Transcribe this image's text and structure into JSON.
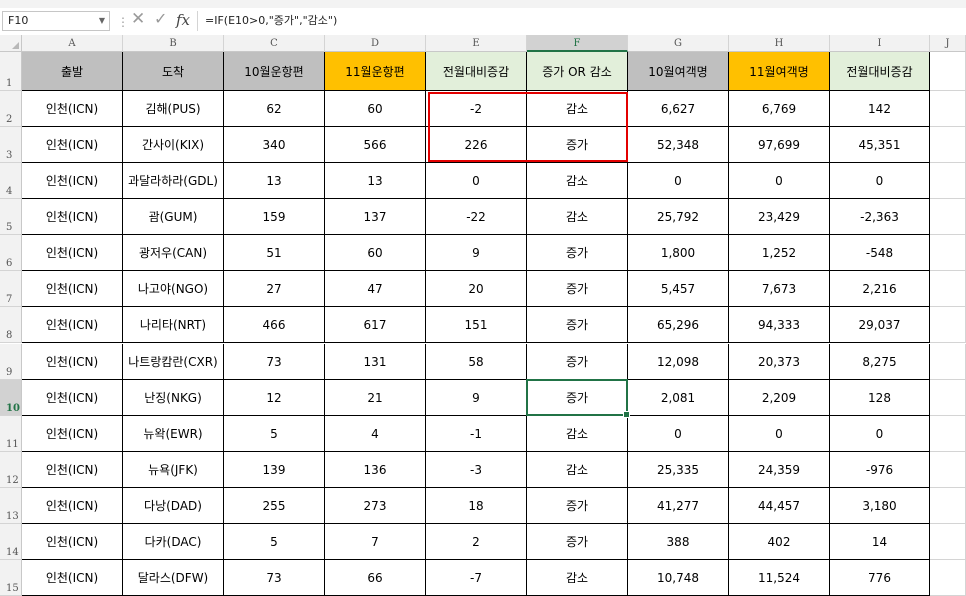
{
  "formula_bar": {
    "name_box": "F10",
    "formula": "=IF(E10>0,\"증가\",\"감소\")",
    "cancel_icon": "close-icon",
    "enter_icon": "check-icon",
    "fx_label": "fx"
  },
  "columns": [
    "A",
    "B",
    "C",
    "D",
    "E",
    "F",
    "G",
    "H",
    "I",
    "J"
  ],
  "rows": [
    "1",
    "2",
    "3",
    "4",
    "5",
    "6",
    "7",
    "8",
    "9",
    "10",
    "11",
    "12",
    "13",
    "14",
    "15"
  ],
  "active_cell": "F10",
  "colors": {
    "header_gray": "#bfbfbf",
    "header_orange": "#ffc000",
    "header_green": "#e2efda",
    "selection_green": "#217346",
    "highlight_red": "#e30000"
  },
  "header": [
    "출발",
    "도착",
    "10월운항편",
    "11월운항편",
    "전월대비증감",
    "증가 OR 감소",
    "10월여객명",
    "11월여객명",
    "전월대비증감"
  ],
  "data": [
    [
      "인천(ICN)",
      "김해(PUS)",
      "62",
      "60",
      "-2",
      "감소",
      "6,627",
      "6,769",
      "142"
    ],
    [
      "인천(ICN)",
      "간사이(KIX)",
      "340",
      "566",
      "226",
      "증가",
      "52,348",
      "97,699",
      "45,351"
    ],
    [
      "인천(ICN)",
      "과달라하라(GDL)",
      "13",
      "13",
      "0",
      "감소",
      "0",
      "0",
      "0"
    ],
    [
      "인천(ICN)",
      "괌(GUM)",
      "159",
      "137",
      "-22",
      "감소",
      "25,792",
      "23,429",
      "-2,363"
    ],
    [
      "인천(ICN)",
      "광저우(CAN)",
      "51",
      "60",
      "9",
      "증가",
      "1,800",
      "1,252",
      "-548"
    ],
    [
      "인천(ICN)",
      "나고야(NGO)",
      "27",
      "47",
      "20",
      "증가",
      "5,457",
      "7,673",
      "2,216"
    ],
    [
      "인천(ICN)",
      "나리타(NRT)",
      "466",
      "617",
      "151",
      "증가",
      "65,296",
      "94,333",
      "29,037"
    ],
    [
      "인천(ICN)",
      "나트랑캄란(CXR)",
      "73",
      "131",
      "58",
      "증가",
      "12,098",
      "20,373",
      "8,275"
    ],
    [
      "인천(ICN)",
      "난징(NKG)",
      "12",
      "21",
      "9",
      "증가",
      "2,081",
      "2,209",
      "128"
    ],
    [
      "인천(ICN)",
      "뉴왁(EWR)",
      "5",
      "4",
      "-1",
      "감소",
      "0",
      "0",
      "0"
    ],
    [
      "인천(ICN)",
      "뉴욕(JFK)",
      "139",
      "136",
      "-3",
      "감소",
      "25,335",
      "24,359",
      "-976"
    ],
    [
      "인천(ICN)",
      "다낭(DAD)",
      "255",
      "273",
      "18",
      "증가",
      "41,277",
      "44,457",
      "3,180"
    ],
    [
      "인천(ICN)",
      "다카(DAC)",
      "5",
      "7",
      "2",
      "증가",
      "388",
      "402",
      "14"
    ],
    [
      "인천(ICN)",
      "달라스(DFW)",
      "73",
      "66",
      "-7",
      "감소",
      "10,748",
      "11,524",
      "776"
    ]
  ]
}
